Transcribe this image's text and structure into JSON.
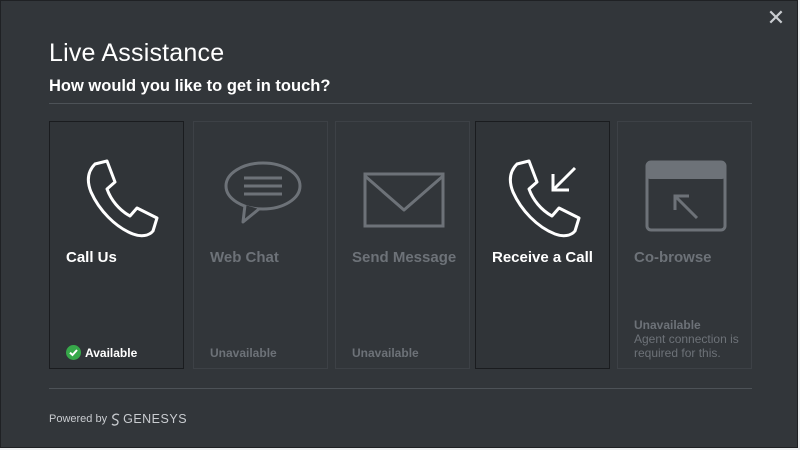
{
  "modal": {
    "title": "Live Assistance",
    "subtitle": "How would you like to get in touch?",
    "close_icon": "close-icon"
  },
  "options": [
    {
      "label": "Call Us",
      "icon": "phone-icon",
      "status": "Available",
      "available": true
    },
    {
      "label": "Web Chat",
      "icon": "chat-bubble-icon",
      "status": "Unavailable",
      "available": false
    },
    {
      "label": "Send Message",
      "icon": "envelope-icon",
      "status": "Unavailable",
      "available": false
    },
    {
      "label": "Receive a Call",
      "icon": "incoming-call-icon",
      "status": "",
      "available": true
    },
    {
      "label": "Co-browse",
      "icon": "cobrowse-icon",
      "status": "Unavailable",
      "status_detail": "Agent connection is required for this.",
      "available": false
    }
  ],
  "footer": {
    "powered_by": "Powered by",
    "brand": "GENESYS"
  },
  "colors": {
    "background": "#32363a",
    "text": "#ffffff",
    "disabled": "#6d7278",
    "available": "#37a84a"
  }
}
